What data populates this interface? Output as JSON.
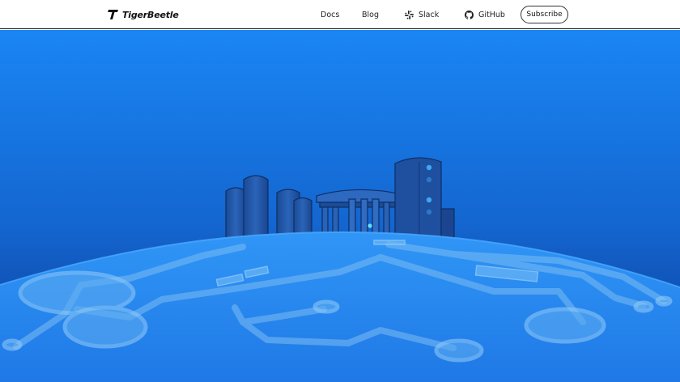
{
  "nav": {
    "brand": "TigerBeetle",
    "links": [
      {
        "label": "Docs"
      },
      {
        "label": "Blog"
      },
      {
        "label": "Slack",
        "icon": "slack-icon"
      },
      {
        "label": "GitHub",
        "icon": "github-icon"
      }
    ],
    "subscribe_label": "Subscribe"
  },
  "colors": {
    "accent": "#1a80f0",
    "sky_top": "#1a86f4",
    "sky_bottom": "#0c3f9e",
    "planet": "#2a86ee"
  },
  "hero": {
    "illustration": "tigerbeetle-planet-with-database-city"
  }
}
